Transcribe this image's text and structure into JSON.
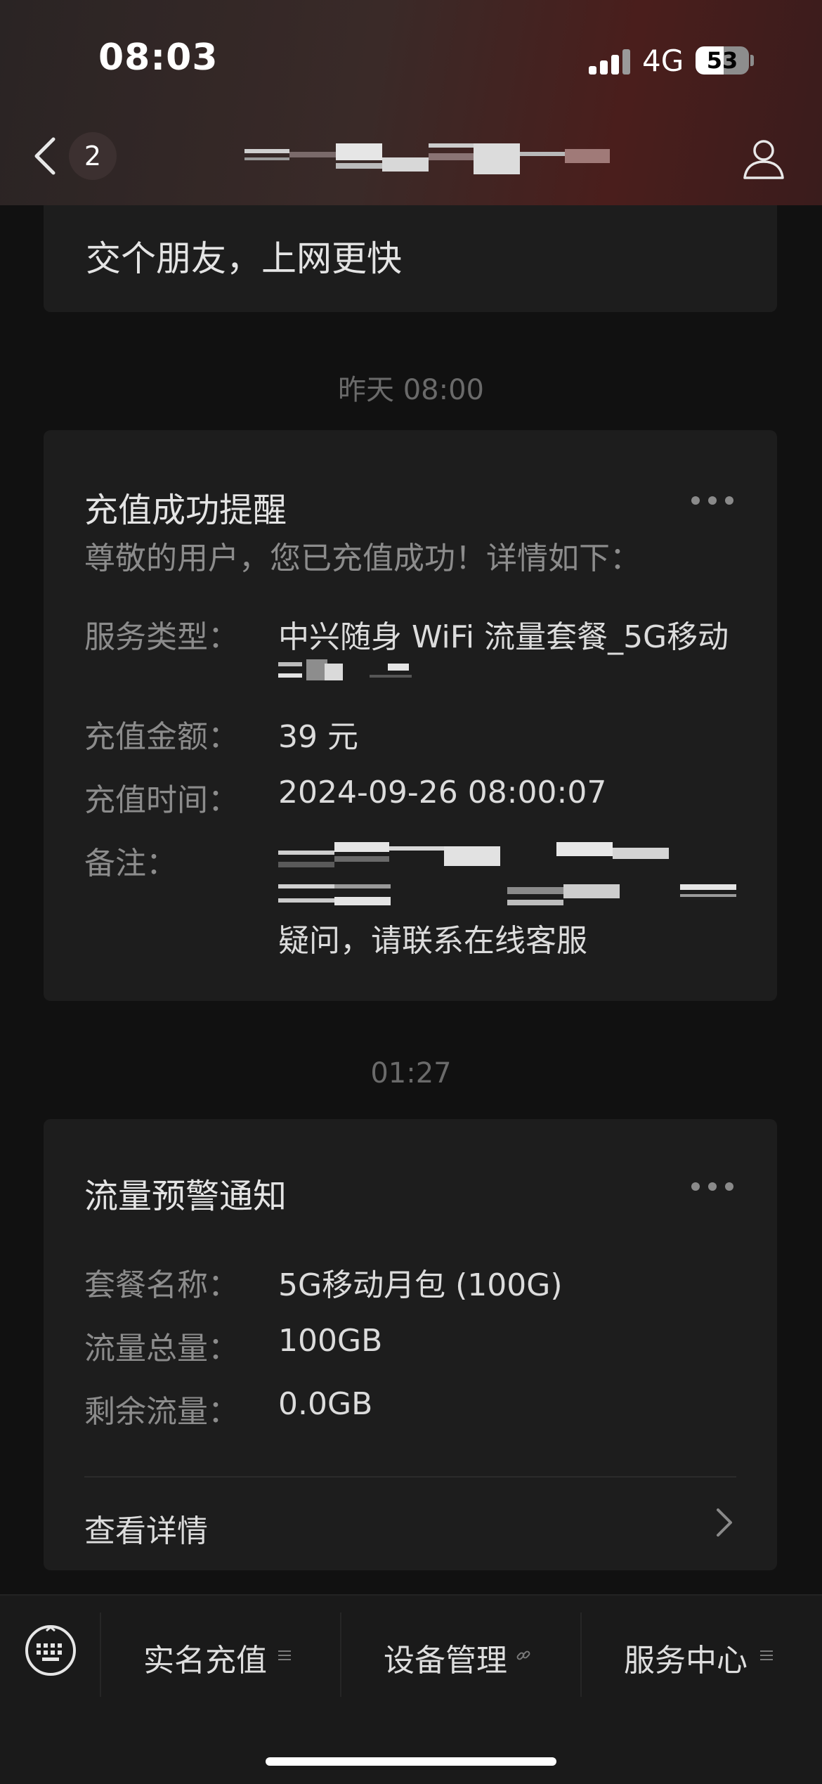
{
  "status_bar": {
    "time": "08:03",
    "network": "4G",
    "battery_level": "53",
    "battery_fraction": 0.53
  },
  "nav": {
    "unread_count": "2"
  },
  "messages": {
    "card0_text": "交个朋友，上网更快",
    "ts1": "昨天 08:00",
    "recharge": {
      "title": "充值成功提醒",
      "greeting": "尊敬的用户，您已充值成功！详情如下：",
      "service_label": "服务类型：",
      "service_value": "中兴随身 WiFi 流量套餐_5G移动",
      "amount_label": "充值金额：",
      "amount_value": "39 元",
      "time_label": "充值时间：",
      "time_value": "2024-09-26 08:00:07",
      "note_label": "备注：",
      "note_tail": "疑问，请联系在线客服"
    },
    "ts2": "01:27",
    "traffic": {
      "title": "流量预警通知",
      "plan_label": "套餐名称：",
      "plan_value": "5G移动月包 (100G)",
      "total_label": "流量总量：",
      "total_value": "100GB",
      "remain_label": "剩余流量：",
      "remain_value": "0.0GB",
      "detail_label": "查看详情"
    }
  },
  "menu": {
    "item1": "实名充值",
    "item2": "设备管理",
    "item3": "服务中心"
  },
  "colors": {
    "background": "#111111",
    "card": "#1d1d1d",
    "header_accent": "#4a1e1c"
  },
  "icons": {
    "back": "chevron-left-icon",
    "profile": "person-icon",
    "more": "more-dots-icon",
    "keyboard": "keyboard-icon",
    "menu": "menu-lines-icon",
    "link": "link-icon"
  }
}
